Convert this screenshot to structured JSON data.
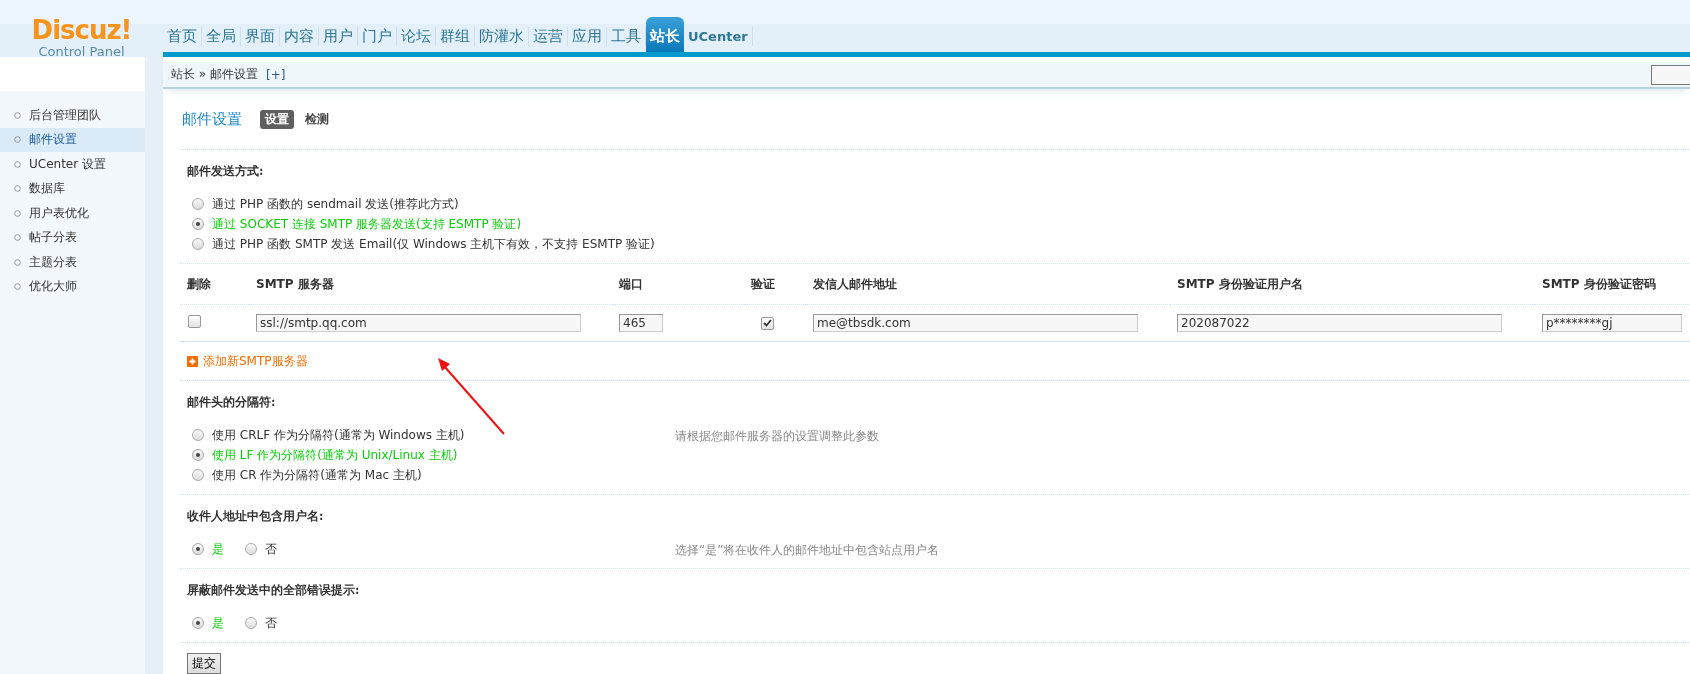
{
  "logo": {
    "name": "Discuz!",
    "subtitle": "Control Panel"
  },
  "nav": [
    {
      "label": "首页",
      "selected": false
    },
    {
      "label": "全局",
      "selected": false
    },
    {
      "label": "界面",
      "selected": false
    },
    {
      "label": "内容",
      "selected": false
    },
    {
      "label": "用户",
      "selected": false
    },
    {
      "label": "门户",
      "selected": false
    },
    {
      "label": "论坛",
      "selected": false
    },
    {
      "label": "群组",
      "selected": false
    },
    {
      "label": "防灌水",
      "selected": false
    },
    {
      "label": "运营",
      "selected": false
    },
    {
      "label": "应用",
      "selected": false
    },
    {
      "label": "工具",
      "selected": false
    },
    {
      "label": "站长",
      "selected": true
    },
    {
      "label": "UCenter",
      "selected": false
    }
  ],
  "breadcrumb": {
    "path": "站长",
    "separator": "»",
    "current": "邮件设置",
    "add": "[+]"
  },
  "sidebar": {
    "items": [
      {
        "label": "后台管理团队",
        "selected": false
      },
      {
        "label": "邮件设置",
        "selected": true
      },
      {
        "label": "UCenter 设置",
        "selected": false
      },
      {
        "label": "数据库",
        "selected": false
      },
      {
        "label": "用户表优化",
        "selected": false
      },
      {
        "label": "帖子分表",
        "selected": false
      },
      {
        "label": "主题分表",
        "selected": false
      },
      {
        "label": "优化大师",
        "selected": false
      }
    ]
  },
  "page": {
    "title": "邮件设置",
    "tabs": [
      {
        "label": "设置",
        "selected": true
      },
      {
        "label": "检测",
        "selected": false
      }
    ]
  },
  "sections": [
    {
      "kind": "radios",
      "title": "邮件发送方式:",
      "options": [
        {
          "label": "通过 PHP 函数的 sendmail 发送(推荐此方式)",
          "selected": false
        },
        {
          "label": "通过 SOCKET 连接 SMTP 服务器发送(支持 ESMTP 验证)",
          "selected": true
        },
        {
          "label": "通过 PHP 函数 SMTP 发送 Email(仅 Windows 主机下有效，不支持 ESMTP 验证)",
          "selected": false
        }
      ]
    },
    {
      "kind": "smtp_table",
      "columns": [
        "删除",
        "SMTP 服务器",
        "端口",
        "验证",
        "发信人邮件地址",
        "SMTP 身份验证用户名",
        "SMTP 身份验证密码"
      ],
      "rows": [
        {
          "delete": false,
          "server": "ssl://smtp.qq.com",
          "port": "465",
          "auth": true,
          "from": "me@tbsdk.com",
          "username": "202087022",
          "password": "p********gj"
        }
      ],
      "add_link": "添加新SMTP服务器"
    },
    {
      "kind": "radios",
      "title": "邮件头的分隔符:",
      "note": "请根据您邮件服务器的设置调整此参数",
      "options": [
        {
          "label": "使用 CRLF 作为分隔符(通常为 Windows 主机)",
          "selected": false
        },
        {
          "label": "使用 LF 作为分隔符(通常为 Unix/Linux 主机)",
          "selected": true
        },
        {
          "label": "使用 CR 作为分隔符(通常为 Mac 主机)",
          "selected": false
        }
      ]
    },
    {
      "kind": "inline_radios",
      "title": "收件人地址中包含用户名:",
      "note": "选择“是”将在收件人的邮件地址中包含站点用户名",
      "options": [
        {
          "label": "是",
          "selected": true
        },
        {
          "label": "否",
          "selected": false
        }
      ]
    },
    {
      "kind": "inline_radios",
      "title": "屏蔽邮件发送中的全部错误提示:",
      "options": [
        {
          "label": "是",
          "selected": true
        },
        {
          "label": "否",
          "selected": false
        }
      ]
    }
  ],
  "submit": "提交",
  "annotation": {
    "kind": "arrow"
  }
}
